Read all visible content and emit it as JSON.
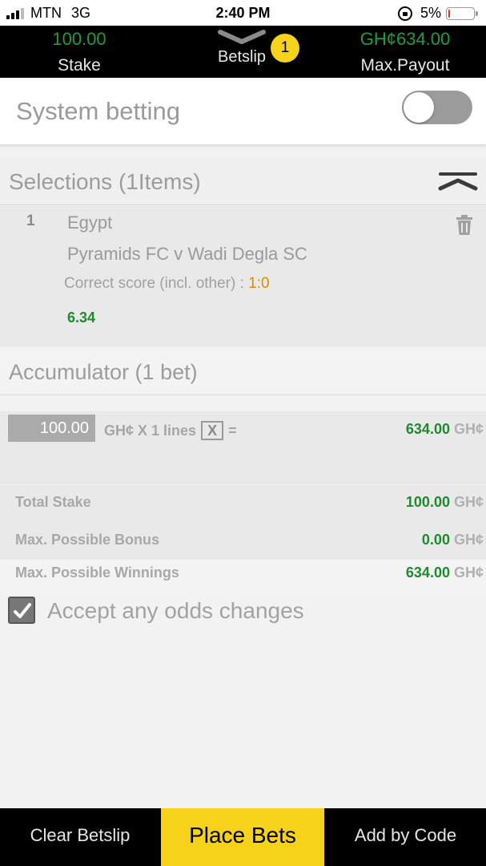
{
  "status_bar": {
    "carrier": "MTN",
    "network": "3G",
    "time": "2:40 PM",
    "battery_pct": "5%",
    "battery_level": 0.05
  },
  "header": {
    "stake_value": "100.00",
    "stake_label": "Stake",
    "betslip_label": "Betslip",
    "betslip_count": "1",
    "payout_value": "GH¢634.00",
    "payout_label": "Max.Payout"
  },
  "system_betting": {
    "label": "System betting",
    "enabled": false
  },
  "selections": {
    "title": "Selections (1Items)",
    "items": [
      {
        "number": "1",
        "country": "Egypt",
        "match": "Pyramids FC v Wadi Degla SC",
        "market": "Correct score (incl. other) : ",
        "pick": "1:0",
        "odds": "6.34"
      }
    ]
  },
  "accumulator": {
    "title": "Accumulator (1 bet)",
    "stake_input": "100.00",
    "formula_text": "GH¢ X 1 lines",
    "x_label": "X",
    "equals": "=",
    "result_value": "634.00",
    "currency": "GH¢"
  },
  "totals": {
    "total_stake_label": "Total Stake",
    "total_stake_value": "100.00",
    "bonus_label": "Max. Possible Bonus",
    "bonus_value": "0.00",
    "winnings_label": "Max. Possible Winnings",
    "winnings_value": "634.00",
    "currency": "GH¢"
  },
  "accept_odds": {
    "label": "Accept any odds changes",
    "checked": true
  },
  "bottom_bar": {
    "clear_label": "Clear Betslip",
    "place_label": "Place Bets",
    "code_label": "Add by Code"
  },
  "colors": {
    "accent_yellow": "#f7d21a",
    "green": "#1e8a2e",
    "orange": "#e08a00",
    "header_bg": "#000000"
  }
}
